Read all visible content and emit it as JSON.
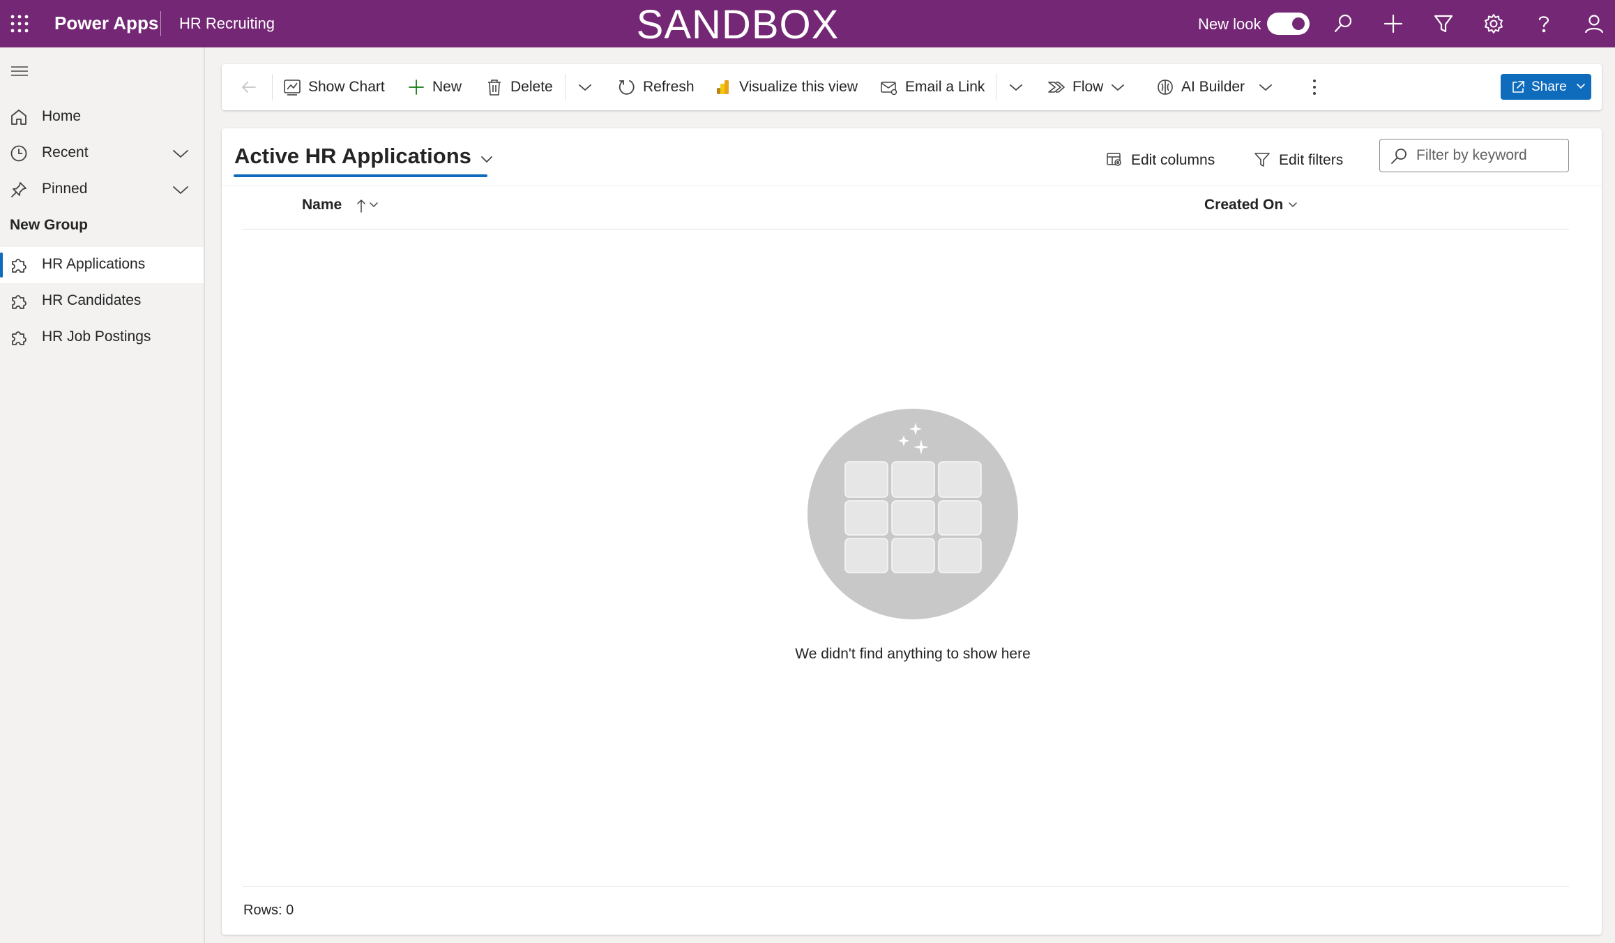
{
  "header": {
    "app_name": "Power Apps",
    "app_subtitle": "HR Recruiting",
    "environment_label": "SANDBOX",
    "new_look_label": "New look",
    "new_look_enabled": true,
    "background_color": "#742774",
    "icons": [
      "waffle-icon",
      "search-icon",
      "plus-icon",
      "filter-icon",
      "settings-icon",
      "help-icon",
      "user-icon"
    ]
  },
  "sidebar": {
    "items": [
      {
        "label": "Home",
        "icon": "home-icon"
      },
      {
        "label": "Recent",
        "icon": "clock-icon"
      },
      {
        "label": "Pinned",
        "icon": "pin-icon"
      }
    ],
    "group_title": "New Group",
    "group_items": [
      {
        "label": "HR Applications",
        "icon": "puzzle-icon",
        "selected": true
      },
      {
        "label": "HR Candidates",
        "icon": "puzzle-icon",
        "selected": false
      },
      {
        "label": "HR Job Postings",
        "icon": "puzzle-icon",
        "selected": false
      }
    ]
  },
  "commandbar": {
    "show_chart": "Show Chart",
    "new": "New",
    "delete": "Delete",
    "refresh": "Refresh",
    "visualize": "Visualize this view",
    "email_link": "Email a Link",
    "flow": "Flow",
    "ai_builder": "AI Builder",
    "share": "Share",
    "accent_color": "#0f6cbd"
  },
  "view": {
    "title": "Active HR Applications",
    "edit_columns": "Edit columns",
    "edit_filters": "Edit filters",
    "search_placeholder": "Filter by keyword",
    "search_value": "",
    "columns": [
      {
        "label": "Name",
        "sort": "ascending"
      },
      {
        "label": "Created On",
        "sort": "none"
      }
    ],
    "empty_message": "We didn't find anything to show here",
    "rows_label": "Rows: 0"
  }
}
